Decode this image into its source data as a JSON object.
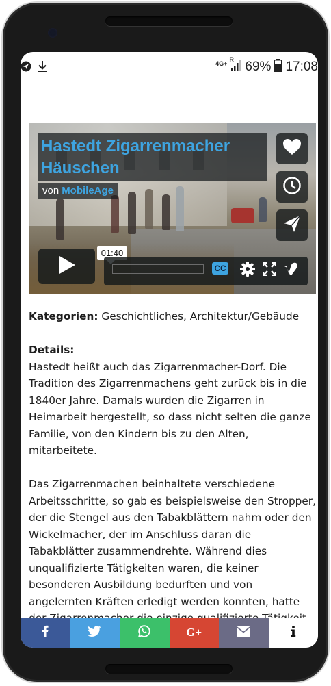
{
  "status_bar": {
    "network": "4G+",
    "signal_marker": "R",
    "battery_percent": "69%",
    "time": "17:08"
  },
  "video": {
    "title": "Hastedt Zigarrenmacher\nHäuschen",
    "byline_prefix": "von",
    "author": "MobileAge",
    "hover_time": "01:40",
    "cc_label": "CC",
    "accent_color": "#3ea4e0"
  },
  "article": {
    "categories_label": "Kategorien:",
    "categories_value": " Geschichtliches, Architektur/Gebäude",
    "details_label": "Details:",
    "paragraph1": "Hastedt heißt auch das Zigarrenmacher-Dorf. Die Tradition des Zigarrenmachens geht zurück bis in die 1840er Jahre. Damals wurden die Zigarren in Heimarbeit hergestellt, so dass nicht selten die ganze Familie, von den Kindern bis zu den Alten, mitarbeitete.",
    "paragraph2": "Das Zigarrenmachen beinhaltete verschiedene Arbeitsschritte, so gab es beispielsweise den Stropper, der die Stengel aus den Tabakblättern nahm oder den Wickelmacher, der im Anschluss daran die Tabakblätter zusammendrehte. Während dies unqualifizierte Tätigkeiten waren, die keiner besonderen Ausbildung bedurften und von angelernten Kräften erledigt werden konnten, hatte der Zigarrenmacher die einzige qualifizierte Tätigkeit im Prozess der"
  },
  "share_bar": {
    "colors": {
      "facebook": "#3b5998",
      "twitter": "#4aa0e0",
      "whatsapp": "#3cc06a",
      "google_plus": "#d64633",
      "email": "#6b6b86",
      "info": "#ffffff"
    },
    "google_plus_label": "G+"
  }
}
